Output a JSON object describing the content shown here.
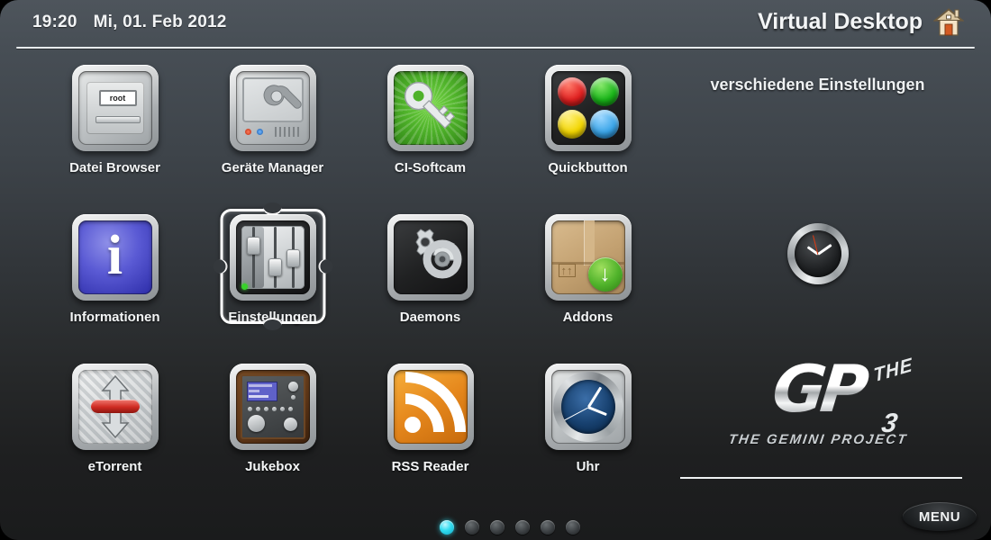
{
  "header": {
    "time": "19:20",
    "date": "Mi, 01. Feb 2012",
    "title": "Virtual Desktop",
    "home_icon": "home-icon"
  },
  "grid": {
    "items": [
      {
        "label": "Datei Browser",
        "icon": "file-browser-icon",
        "badge": "root",
        "selected": false
      },
      {
        "label": "Geräte Manager",
        "icon": "device-manager-icon",
        "selected": false
      },
      {
        "label": "CI-Softcam",
        "icon": "key-icon",
        "selected": false
      },
      {
        "label": "Quickbutton",
        "icon": "quickbutton-icon",
        "selected": false
      },
      {
        "label": "Informationen",
        "icon": "info-icon",
        "glyph": "i",
        "selected": false
      },
      {
        "label": "Einstellungen",
        "icon": "settings-sliders-icon",
        "selected": true
      },
      {
        "label": "Daemons",
        "icon": "gears-icon",
        "selected": false
      },
      {
        "label": "Addons",
        "icon": "package-download-icon",
        "selected": false
      },
      {
        "label": "eTorrent",
        "icon": "etorrent-icon",
        "selected": false
      },
      {
        "label": "Jukebox",
        "icon": "jukebox-icon",
        "selected": false
      },
      {
        "label": "RSS Reader",
        "icon": "rss-icon",
        "selected": false
      },
      {
        "label": "Uhr",
        "icon": "clock-icon",
        "selected": false
      }
    ]
  },
  "right_panel": {
    "description": "verschiedene Einstellungen",
    "gauge_icon": "analog-clock-icon",
    "logo": {
      "main": "GP",
      "superscript": "THE",
      "numeral": "3",
      "subtitle": "THE GEMINI PROJECT"
    }
  },
  "footer": {
    "menu_label": "MENU",
    "page_dots": {
      "total": 6,
      "active_index": 0
    }
  },
  "colors": {
    "accent": "#30dcf0",
    "text": "#f2f4f5",
    "rule": "#eef1f2",
    "bg_top": "#4e555c",
    "bg_bottom": "#1a1b1c",
    "quickbutton_red": "#e02020",
    "quickbutton_green": "#19b519",
    "quickbutton_yellow": "#f2d500",
    "quickbutton_blue": "#3aa5e8"
  }
}
